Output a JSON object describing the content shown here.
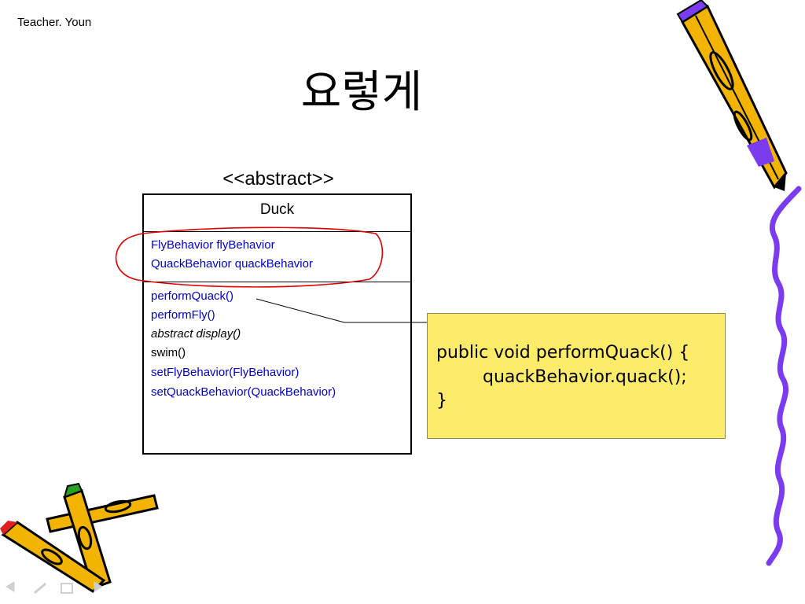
{
  "header": {
    "author": "Teacher. Youn"
  },
  "slide": {
    "title": "요렇게"
  },
  "uml": {
    "stereotype": "<<abstract>>",
    "class_name": "Duck",
    "attributes": [
      "FlyBehavior flyBehavior",
      "QuackBehavior quackBehavior"
    ],
    "methods": [
      "performQuack()",
      "performFly()",
      "abstract display()",
      "swim()",
      "setFlyBehavior(FlyBehavior)",
      "setQuackBehavior(QuackBehavior)"
    ]
  },
  "note": {
    "code_lines": [
      "public void performQuack() {",
      "quackBehavior.quack();",
      "}"
    ]
  },
  "colors": {
    "member_text": "#0000cc",
    "highlight_ellipse": "#e00000",
    "note_fill": "#fcec6a",
    "squiggle": "#7b3cf0",
    "pencil_body": "#f2b400"
  },
  "icons": [
    "pencil-icon",
    "crossed-pencils-icon",
    "squiggle-decoration",
    "prev-arrow-icon",
    "pen-icon",
    "menu-icon",
    "next-arrow-icon"
  ]
}
